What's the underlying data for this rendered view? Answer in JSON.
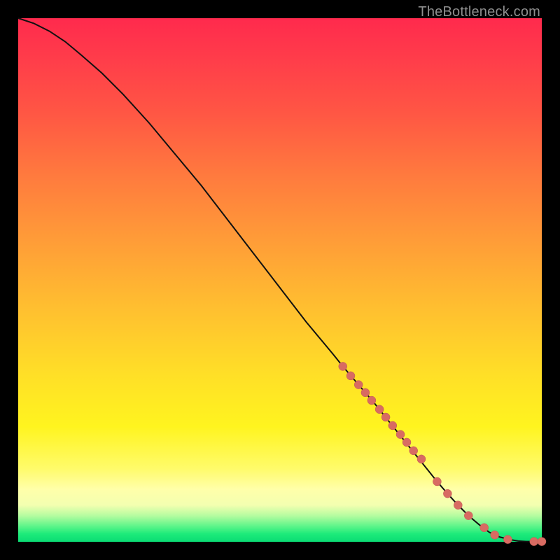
{
  "watermark": "TheBottleneck.com",
  "colors": {
    "line": "#111111",
    "marker_fill": "#d86b62",
    "marker_stroke": "#c05a52"
  },
  "chart_data": {
    "type": "line",
    "title": "",
    "xlabel": "",
    "ylabel": "",
    "xlim": [
      0,
      100
    ],
    "ylim": [
      0,
      100
    ],
    "grid": false,
    "legend": false,
    "series": [
      {
        "name": "curve",
        "style": "line",
        "x": [
          0,
          3,
          6,
          9,
          12,
          16,
          20,
          25,
          30,
          35,
          40,
          45,
          50,
          55,
          60,
          62,
          65,
          68,
          70,
          72,
          74,
          76,
          78,
          80,
          82,
          84,
          86,
          88,
          90,
          92,
          94,
          95.5,
          97,
          100
        ],
        "y": [
          100,
          99,
          97.5,
          95.5,
          93,
          89.5,
          85.5,
          80,
          74,
          68,
          61.5,
          55,
          48.5,
          42,
          36,
          33.5,
          30,
          26.5,
          24,
          21.5,
          19,
          16.5,
          14,
          11.5,
          9.2,
          7.0,
          5.0,
          3.3,
          1.8,
          0.9,
          0.4,
          0.15,
          0.05,
          0.05
        ]
      },
      {
        "name": "markers-dense",
        "style": "scatter",
        "marker_radius": 6,
        "x": [
          62,
          63.5,
          65,
          66.3,
          67.5,
          69,
          70.2,
          71.5,
          73,
          74.2,
          75.5,
          77
        ],
        "y": [
          33.5,
          31.7,
          30.0,
          28.5,
          27.0,
          25.3,
          23.8,
          22.2,
          20.5,
          19.0,
          17.4,
          15.8
        ]
      },
      {
        "name": "markers-lower",
        "style": "scatter",
        "marker_radius": 6,
        "x": [
          80,
          82,
          84,
          86,
          89,
          91,
          93.5
        ],
        "y": [
          11.5,
          9.2,
          7.0,
          5.0,
          2.7,
          1.3,
          0.45
        ]
      },
      {
        "name": "markers-end",
        "style": "scatter",
        "marker_radius": 6,
        "x": [
          98.5,
          100
        ],
        "y": [
          0.05,
          0.05
        ]
      }
    ]
  }
}
